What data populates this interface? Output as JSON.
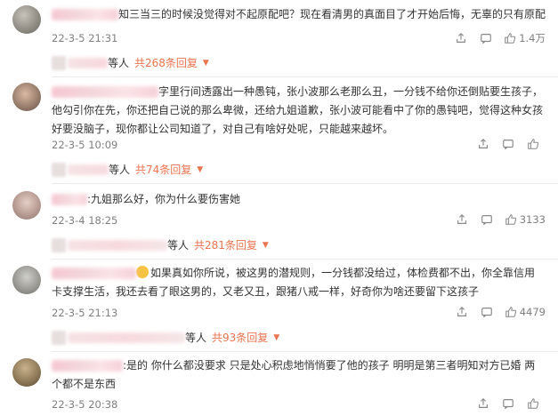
{
  "comments": [
    {
      "text_lines": [
        "知三当三的时候没觉得对不起原配吧？现在看清男的真面目了才开始后悔，无辜的只有原配"
      ],
      "time": "22-3-5 21:31",
      "likes": "1.4万",
      "replies": {
        "suffix": "等人",
        "link": "共268条回复"
      }
    },
    {
      "text_lines": [
        "字里行间透露出一种愚钝，张小波那么老那么丑，一分钱不给你还倒贴要生孩子，",
        "他勾引你在先，你还把自己说的那么卑微，还给九姐道歉，张小波可能看中了你的愚钝吧，觉得这种女孩",
        "好要没脑子，现你都让公司知道了，对自己有啥好处呢，只能越来越坏。"
      ],
      "time": "22-3-5 10:09",
      "likes": "",
      "replies": {
        "suffix": "等人",
        "link": "共74条回复"
      }
    },
    {
      "text_lines": [
        ":九姐那么好，你为什么要伤害她"
      ],
      "time": "22-3-4 18:25",
      "likes": "3133",
      "replies": {
        "suffix": "等人",
        "link": "共281条回复"
      }
    },
    {
      "text_lines": [
        "如果真如你所说，被这男的潜规则，一分钱都没给过，体检费都不出，你全靠信用",
        "卡支撑生活，我还去看了眼这男的，又老又丑，跟猪八戒一样，好奇你为啥还要留下这孩子"
      ],
      "time": "22-3-5 21:13",
      "likes": "4479",
      "replies": {
        "suffix": "等人",
        "link": "共93条回复"
      }
    },
    {
      "text_lines": [
        ":是的 你什么都没要求 只是处心积虑地悄悄要了他的孩子 明明是第三者明知对方已婚 两",
        "个都不是东西"
      ],
      "time": "22-3-5 20:38",
      "likes": "",
      "replies": null
    }
  ],
  "icons": [
    "share-icon",
    "comment-icon",
    "like-icon",
    "caret-down-icon"
  ],
  "colors": {
    "link": "#eb7350",
    "meta": "#808080",
    "text": "#333333"
  }
}
